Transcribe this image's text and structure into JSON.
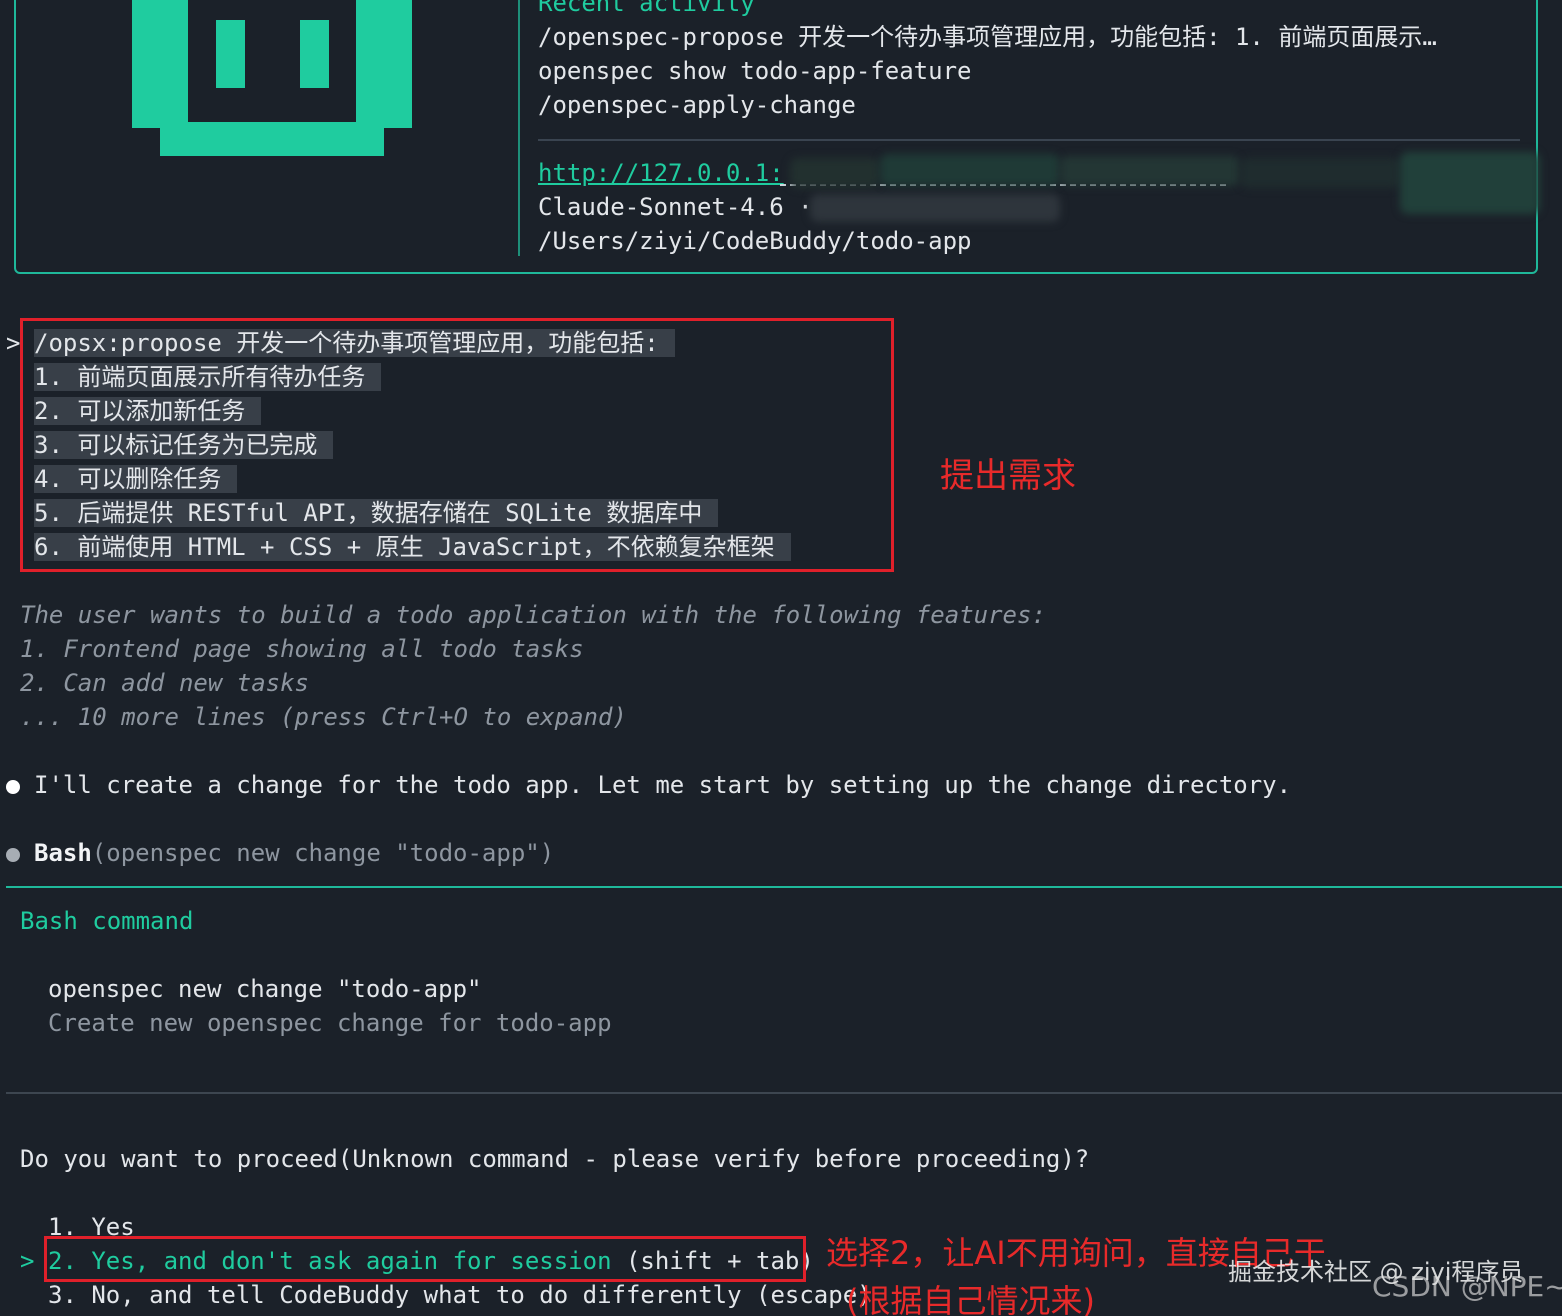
{
  "header": {
    "recent_activity_title": "Recent activity",
    "recent_items": [
      "/openspec-propose 开发一个待办事项管理应用，功能包括: 1. 前端页面展示…",
      "openspec show todo-app-feature",
      "/openspec-apply-change"
    ],
    "url": "http://127.0.0.1:",
    "model": "Claude-Sonnet-4.6 ·",
    "cwd": "/Users/ziyi/CodeBuddy/todo-app"
  },
  "prompt": {
    "caret": ">",
    "lines": [
      "/opsx:propose 开发一个待办事项管理应用，功能包括:",
      "1. 前端页面展示所有待办任务",
      "2. 可以添加新任务",
      "3. 可以标记任务为已完成",
      "4. 可以删除任务",
      "5. 后端提供 RESTful API，数据存储在 SQLite 数据库中",
      "6. 前端使用 HTML + CSS + 原生 JavaScript，不依赖复杂框架"
    ]
  },
  "annotations": {
    "requirement": "提出需求",
    "choose2_line1": "选择2，让AI不用询问，直接自己干",
    "choose2_line2": "(根据自己情况来)"
  },
  "thinking": {
    "lines": [
      "The user wants to build a todo application with the following features:",
      "1. Frontend page showing all todo tasks",
      "2. Can add new tasks",
      "... 10 more lines (press Ctrl+O to expand)"
    ]
  },
  "assistant": {
    "message": "I'll create a change for the todo app. Let me start by setting up the change directory.",
    "tool_name": "Bash",
    "tool_args": "(openspec new change \"todo-app\")"
  },
  "bash_panel": {
    "title": "Bash command",
    "command": "openspec new change \"todo-app\"",
    "description": "Create new openspec change for todo-app"
  },
  "confirm": {
    "question": "Do you want to proceed(Unknown command - please verify before proceeding)?",
    "selected_caret": ">",
    "option1": "1. Yes",
    "option2_main": "2. Yes, and don't ask again for session",
    "option2_hint": " (shift + tab)",
    "option3": "3. No, and tell CodeBuddy what to do differently (escape)"
  },
  "watermarks": {
    "juejin": "掘金技术社区 @ ziyi程序员",
    "csdn": "CSDN @NPE~"
  },
  "colors": {
    "accent": "#1fcc9f",
    "annotation_red": "#e0202a",
    "background": "#1b2129"
  }
}
